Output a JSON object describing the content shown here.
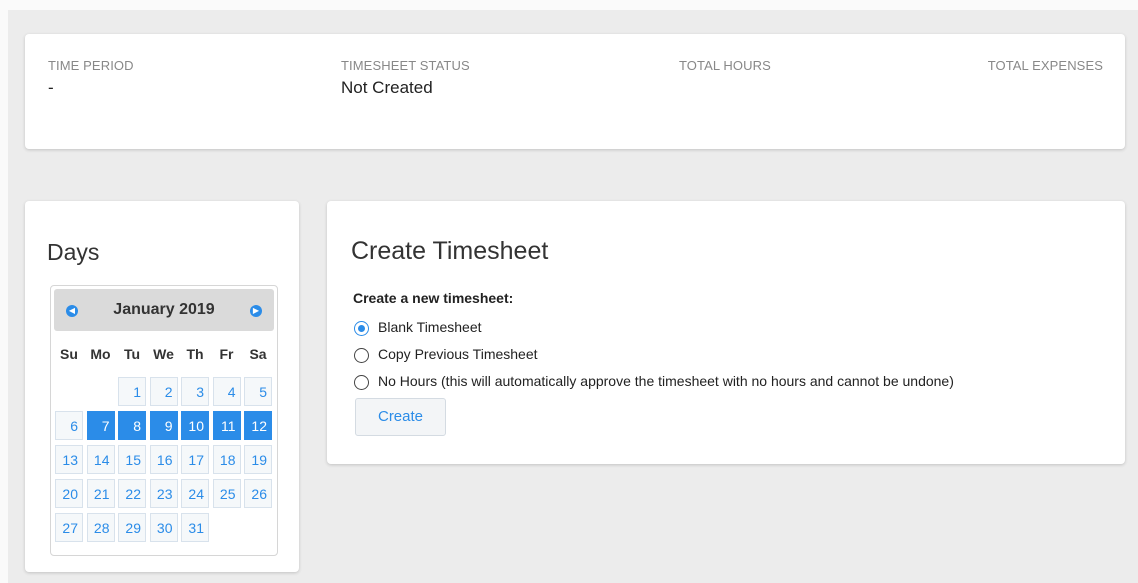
{
  "summary": {
    "time_period": {
      "label": "TIME PERIOD",
      "value": "-"
    },
    "timesheet_status": {
      "label": "TIMESHEET STATUS",
      "value": "Not Created"
    },
    "total_hours": {
      "label": "TOTAL HOURS",
      "value": ""
    },
    "total_expenses": {
      "label": "TOTAL EXPENSES",
      "value": ""
    }
  },
  "days": {
    "title": "Days",
    "calendar": {
      "month_label": "January 2019",
      "prev_icon": "chevron-left-icon",
      "next_icon": "chevron-right-icon",
      "weekdays": [
        "Su",
        "Mo",
        "Tu",
        "We",
        "Th",
        "Fr",
        "Sa"
      ],
      "first_weekday_index": 2,
      "days_in_month": 31,
      "selected_days": [
        7,
        8,
        9,
        10,
        11,
        12
      ]
    }
  },
  "create": {
    "title": "Create Timesheet",
    "subtitle": "Create a new timesheet:",
    "options": [
      {
        "label": "Blank Timesheet",
        "checked": true
      },
      {
        "label": "Copy Previous Timesheet",
        "checked": false
      },
      {
        "label": "No Hours (this will automatically approve the timesheet with no hours and cannot be undone)",
        "checked": false
      }
    ],
    "button_label": "Create"
  },
  "colors": {
    "accent": "#2b8ce8",
    "page_bg": "#ececec",
    "card_bg": "#ffffff",
    "muted_text": "#888888"
  }
}
